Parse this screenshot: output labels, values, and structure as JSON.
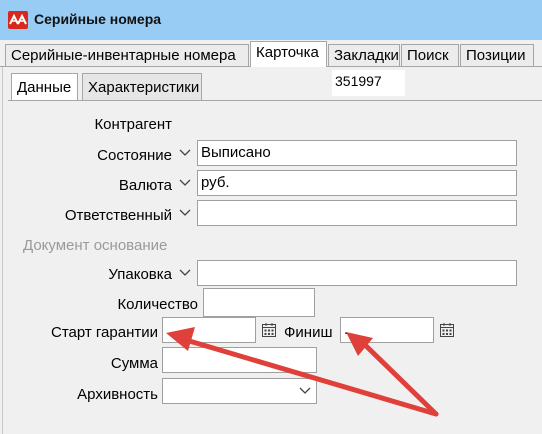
{
  "window": {
    "title": "Серийные номера",
    "app_icon": "app-logo-icon"
  },
  "tabs": [
    {
      "label": "Серийные-инвентарные номера"
    },
    {
      "label": "Карточка",
      "active": true
    },
    {
      "label": "Закладки"
    },
    {
      "label": "Поиск"
    },
    {
      "label": "Позиции"
    }
  ],
  "subtabs": [
    {
      "label": "Данные",
      "active": true
    },
    {
      "label": "Характеристики"
    }
  ],
  "card_number": "351997",
  "form": {
    "contragent_label": "Контрагент",
    "status_label": "Состояние",
    "status_value": "Выписано",
    "currency_label": "Валюта",
    "currency_value": "руб.",
    "responsible_label": "Ответственный",
    "responsible_value": "",
    "base_doc_label": "Документ основание",
    "package_label": "Упаковка",
    "package_value": "",
    "quantity_label": "Количество",
    "quantity_value": "",
    "warranty_start_label": "Старт гарантии",
    "warranty_start_value": "",
    "finish_label": "Финиш",
    "finish_value": ".",
    "sum_label": "Сумма",
    "sum_value": "",
    "archive_label": "Архивность",
    "archive_value": ""
  },
  "colors": {
    "titlebar": "#99ccf4",
    "annotation_arrow": "#e0403a"
  },
  "icons": [
    "app-logo-icon",
    "chevron-down-icon",
    "calendar-icon"
  ]
}
